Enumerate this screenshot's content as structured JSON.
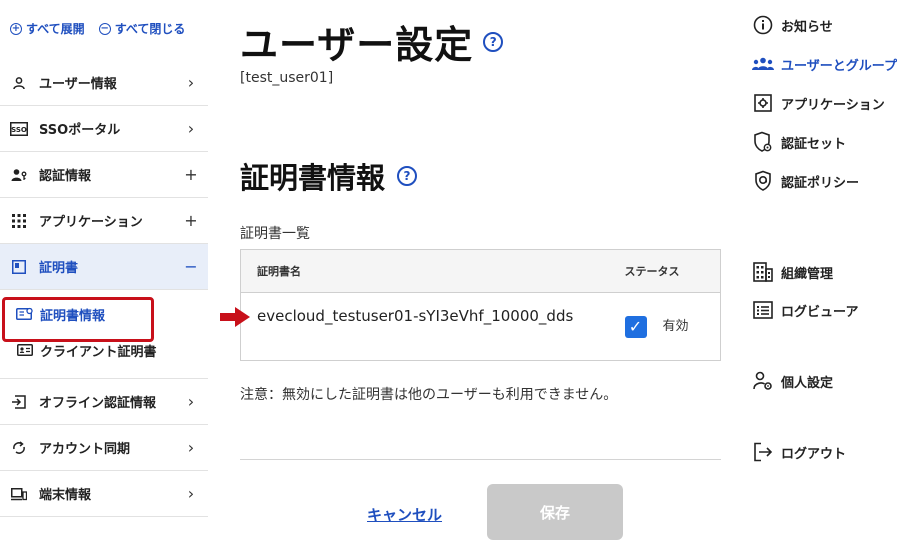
{
  "sidebar": {
    "expand_all": "すべて展開",
    "collapse_all": "すべて閉じる",
    "items": [
      {
        "label": "ユーザー情報",
        "tail": "›"
      },
      {
        "label": "SSOポータル",
        "tail": "›"
      },
      {
        "label": "認証情報",
        "tail": "+"
      },
      {
        "label": "アプリケーション",
        "tail": "+"
      },
      {
        "label": "証明書",
        "tail": "−"
      }
    ],
    "sub_items": [
      {
        "label": "証明書情報"
      },
      {
        "label": "クライアント証明書"
      }
    ],
    "items_after": [
      {
        "label": "オフライン認証情報",
        "tail": "›"
      },
      {
        "label": "アカウント同期",
        "tail": "›"
      },
      {
        "label": "端末情報",
        "tail": "›"
      }
    ]
  },
  "main": {
    "title": "ユーザー設定",
    "user_id": "[test_user01]",
    "section_title": "証明書情報",
    "list_label": "証明書一覧",
    "table": {
      "headers": [
        "証明書名",
        "ステータス"
      ],
      "rows": [
        {
          "name": "evecloud_testuser01-sYI3eVhf_10000_dds",
          "status": "有効",
          "checked": true
        }
      ]
    },
    "note": "注意：無効にした証明書は他のユーザーも利用できません。",
    "cancel_label": "キャンセル",
    "save_label": "保存",
    "help_glyph": "?"
  },
  "right_nav": {
    "items": [
      {
        "label": "お知らせ",
        "icon": "info-icon"
      },
      {
        "label": "ユーザーとグループ",
        "icon": "users-icon"
      },
      {
        "label": "アプリケーション",
        "icon": "app-icon"
      },
      {
        "label": "認証セット",
        "icon": "shield-gear-icon"
      },
      {
        "label": "認証ポリシー",
        "icon": "shield-policy-icon"
      },
      {
        "label": "組織管理",
        "icon": "building-icon"
      },
      {
        "label": "ログビューア",
        "icon": "log-viewer-icon"
      },
      {
        "label": "個人設定",
        "icon": "person-gear-icon"
      },
      {
        "label": "ログアウト",
        "icon": "logout-icon"
      }
    ]
  },
  "colors": {
    "accent": "#1f4fbf",
    "highlight": "#c8101a",
    "checkbox": "#1f6fe0",
    "save_disabled": "#c9c9c9"
  }
}
